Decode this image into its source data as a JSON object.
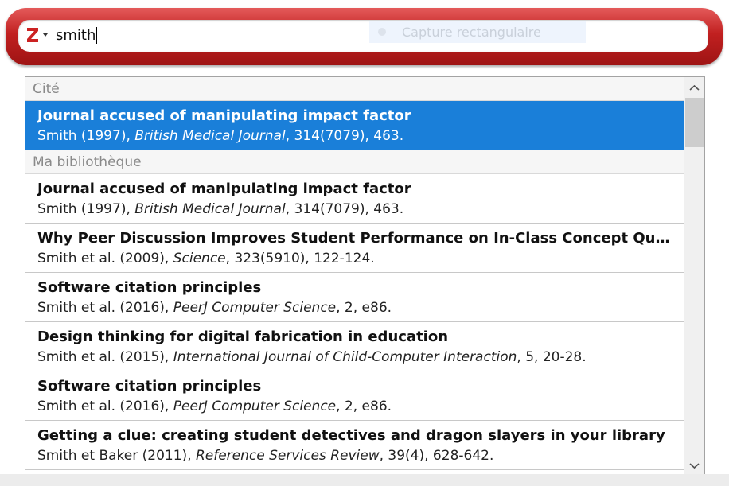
{
  "search": {
    "query": "smith",
    "overlay_label": "Capture rectangulaire"
  },
  "colors": {
    "bar_red": "#c12020",
    "selection_blue": "#1a7fd9"
  },
  "sections": {
    "cited": "Cité",
    "library": "Ma bibliothèque"
  },
  "cited_items": [
    {
      "title": "Journal accused of manipulating impact factor",
      "authors": "Smith (1997), ",
      "venue": "British Medical Journal",
      "details": ", 314(7079), 463."
    }
  ],
  "library_items": [
    {
      "title": "Journal accused of manipulating impact factor",
      "authors": "Smith (1997), ",
      "venue": "British Medical Journal",
      "details": ", 314(7079), 463."
    },
    {
      "title": "Why Peer Discussion Improves Student Performance on In-Class Concept Questions",
      "authors": "Smith et al. (2009), ",
      "venue": "Science",
      "details": ", 323(5910), 122-124."
    },
    {
      "title": "Software citation principles",
      "authors": "Smith et al. (2016), ",
      "venue": "PeerJ Computer Science",
      "details": ", 2, e86."
    },
    {
      "title": "Design thinking for digital fabrication in education",
      "authors": "Smith et al. (2015), ",
      "venue": "International Journal of Child-Computer Interaction",
      "details": ", 5, 20-28."
    },
    {
      "title": "Software citation principles",
      "authors": "Smith et al. (2016), ",
      "venue": "PeerJ Computer Science",
      "details": ", 2, e86."
    },
    {
      "title": "Getting a clue: creating student detectives and dragon slayers in your library",
      "authors": "Smith et Baker (2011), ",
      "venue": "Reference Services Review",
      "details": ", 39(4), 628-642."
    }
  ],
  "icons": {
    "logo": "zotero-logo-icon",
    "logo_menu": "chevron-down-icon",
    "scroll_up": "chevron-up-icon",
    "scroll_down": "chevron-down-icon"
  }
}
